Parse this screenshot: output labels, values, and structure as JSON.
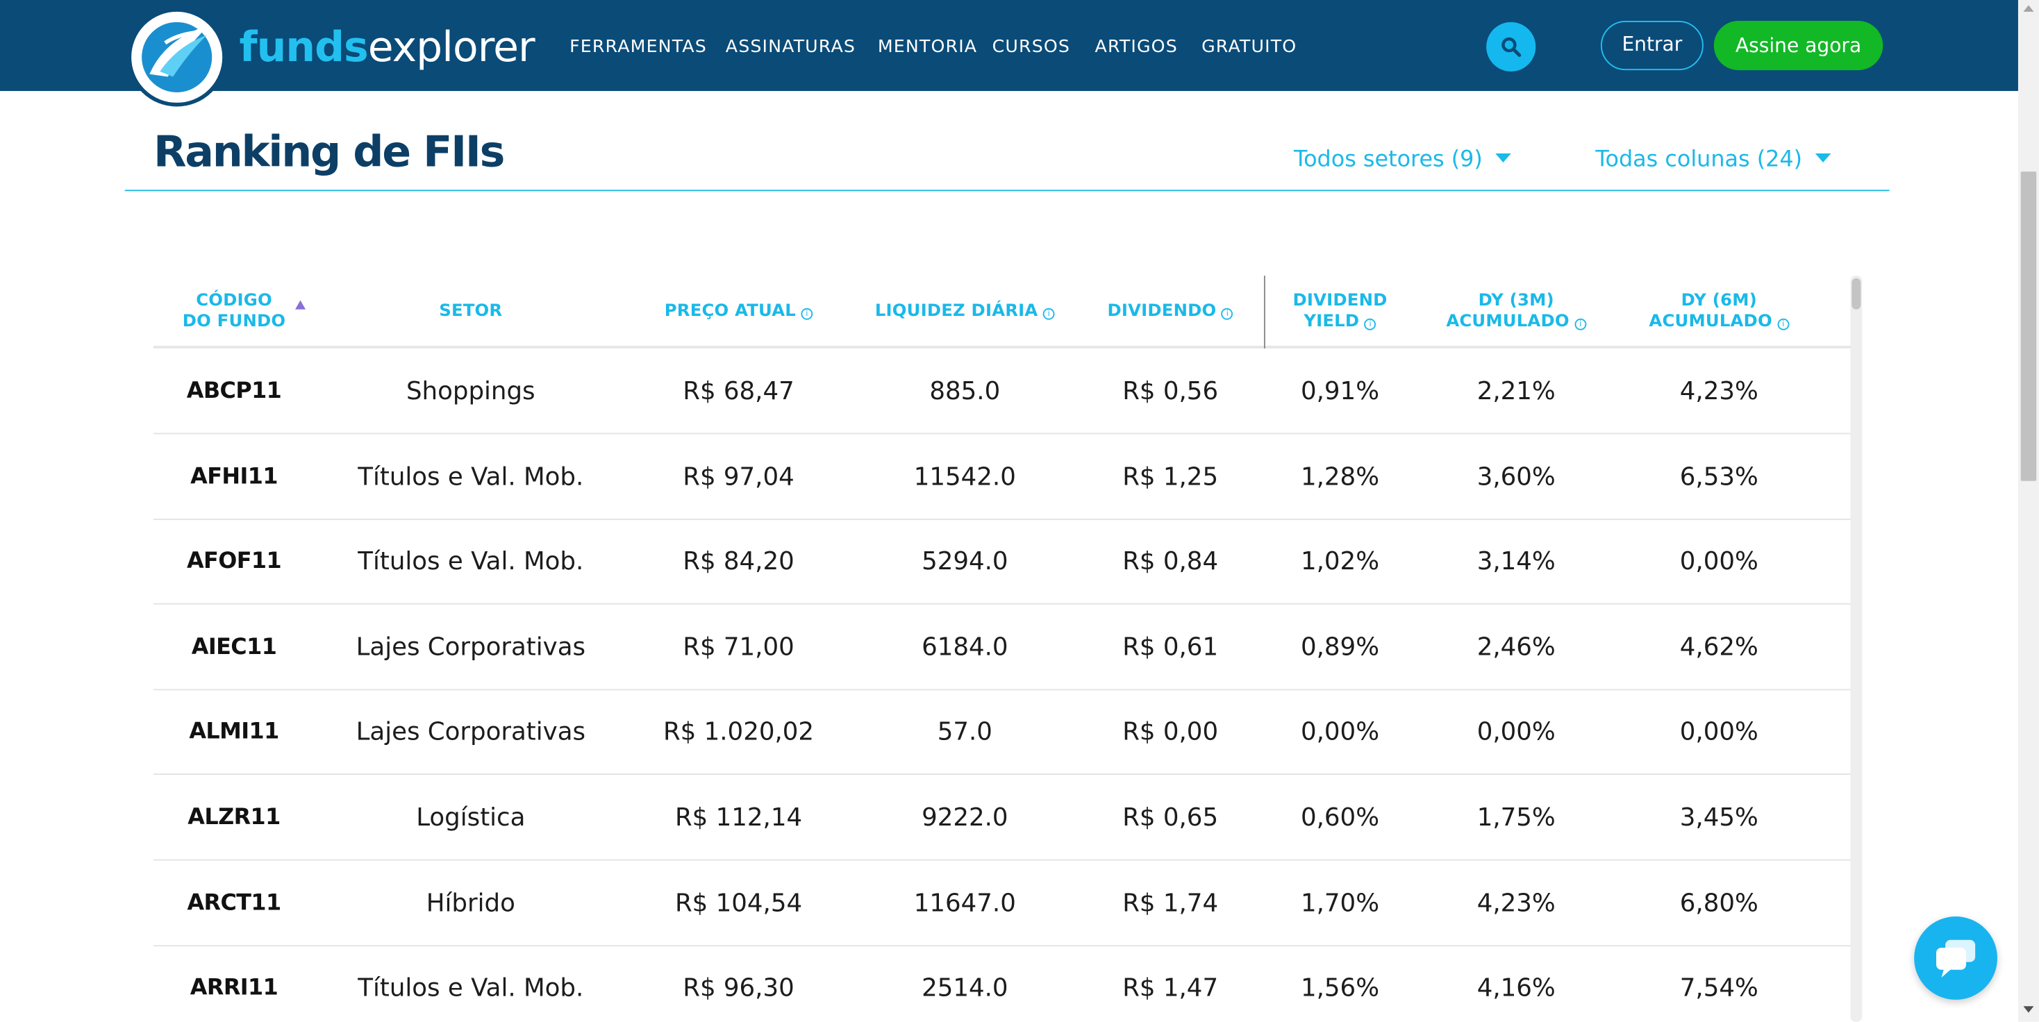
{
  "header": {
    "brand_part1": "funds",
    "brand_part2": "explorer",
    "nav": [
      "FERRAMENTAS",
      "ASSINATURAS",
      "MENTORIA",
      "CURSOS",
      "ARTIGOS",
      "GRATUITO"
    ],
    "login_label": "Entrar",
    "subscribe_label": "Assine agora"
  },
  "page": {
    "title": "Ranking de FIIs",
    "filter_sectors": "Todos setores (9)",
    "filter_columns": "Todas colunas (24)"
  },
  "table": {
    "columns": [
      {
        "label": "CÓDIGO\nDO FUNDO",
        "info": false,
        "sorted": "asc"
      },
      {
        "label": "SETOR",
        "info": false
      },
      {
        "label": "PREÇO ATUAL",
        "info": true
      },
      {
        "label": "LIQUIDEZ DIÁRIA",
        "info": true
      },
      {
        "label": "DIVIDENDO",
        "info": true
      },
      {
        "label": "DIVIDEND\nYIELD",
        "info": true
      },
      {
        "label": "DY (3M)\nACUMULADO",
        "info": true
      },
      {
        "label": "DY (6M)\nACUMULADO",
        "info": true
      }
    ],
    "rows": [
      [
        "ABCP11",
        "Shoppings",
        "R$ 68,47",
        "885.0",
        "R$ 0,56",
        "0,91%",
        "2,21%",
        "4,23%"
      ],
      [
        "AFHI11",
        "Títulos e Val. Mob.",
        "R$ 97,04",
        "11542.0",
        "R$ 1,25",
        "1,28%",
        "3,60%",
        "6,53%"
      ],
      [
        "AFOF11",
        "Títulos e Val. Mob.",
        "R$ 84,20",
        "5294.0",
        "R$ 0,84",
        "1,02%",
        "3,14%",
        "0,00%"
      ],
      [
        "AIEC11",
        "Lajes Corporativas",
        "R$ 71,00",
        "6184.0",
        "R$ 0,61",
        "0,89%",
        "2,46%",
        "4,62%"
      ],
      [
        "ALMI11",
        "Lajes Corporativas",
        "R$ 1.020,02",
        "57.0",
        "R$ 0,00",
        "0,00%",
        "0,00%",
        "0,00%"
      ],
      [
        "ALZR11",
        "Logística",
        "R$ 112,14",
        "9222.0",
        "R$ 0,65",
        "0,60%",
        "1,75%",
        "3,45%"
      ],
      [
        "ARCT11",
        "Híbrido",
        "R$ 104,54",
        "11647.0",
        "R$ 1,74",
        "1,70%",
        "4,23%",
        "6,80%"
      ],
      [
        "ARRI11",
        "Títulos e Val. Mob.",
        "R$ 96,30",
        "2514.0",
        "R$ 1,47",
        "1,56%",
        "4,16%",
        "7,54%"
      ]
    ]
  },
  "colors": {
    "header_bg": "#0a4b78",
    "accent": "#1ab9e8",
    "cta_green": "#12b826",
    "title": "#0d3f66",
    "sort_indicator": "#8a6fd8"
  },
  "icons": {
    "logo": "fundsexplorer-logo-icon",
    "search": "search-icon",
    "chat": "chat-icon",
    "info": "info-icon",
    "caret": "caret-down-icon",
    "sort": "sort-asc-icon"
  }
}
